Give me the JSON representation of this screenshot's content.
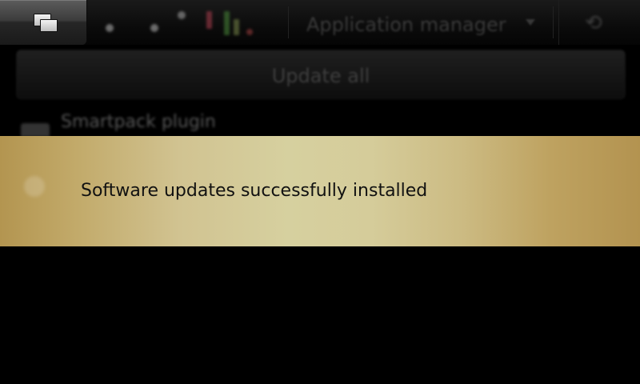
{
  "topbar": {
    "switcher_icon": "task-switcher-icon",
    "title": "Application manager",
    "title_dropdown_icon": "chevron-down-icon",
    "close_icon": "close-icon"
  },
  "content": {
    "update_all_label": "Update all",
    "list_item_label": "Smartpack plugin"
  },
  "banner": {
    "message": "Software updates successfully installed",
    "colors": {
      "gold_edge": "#b39550",
      "gold_center": "#d6d09f"
    }
  }
}
